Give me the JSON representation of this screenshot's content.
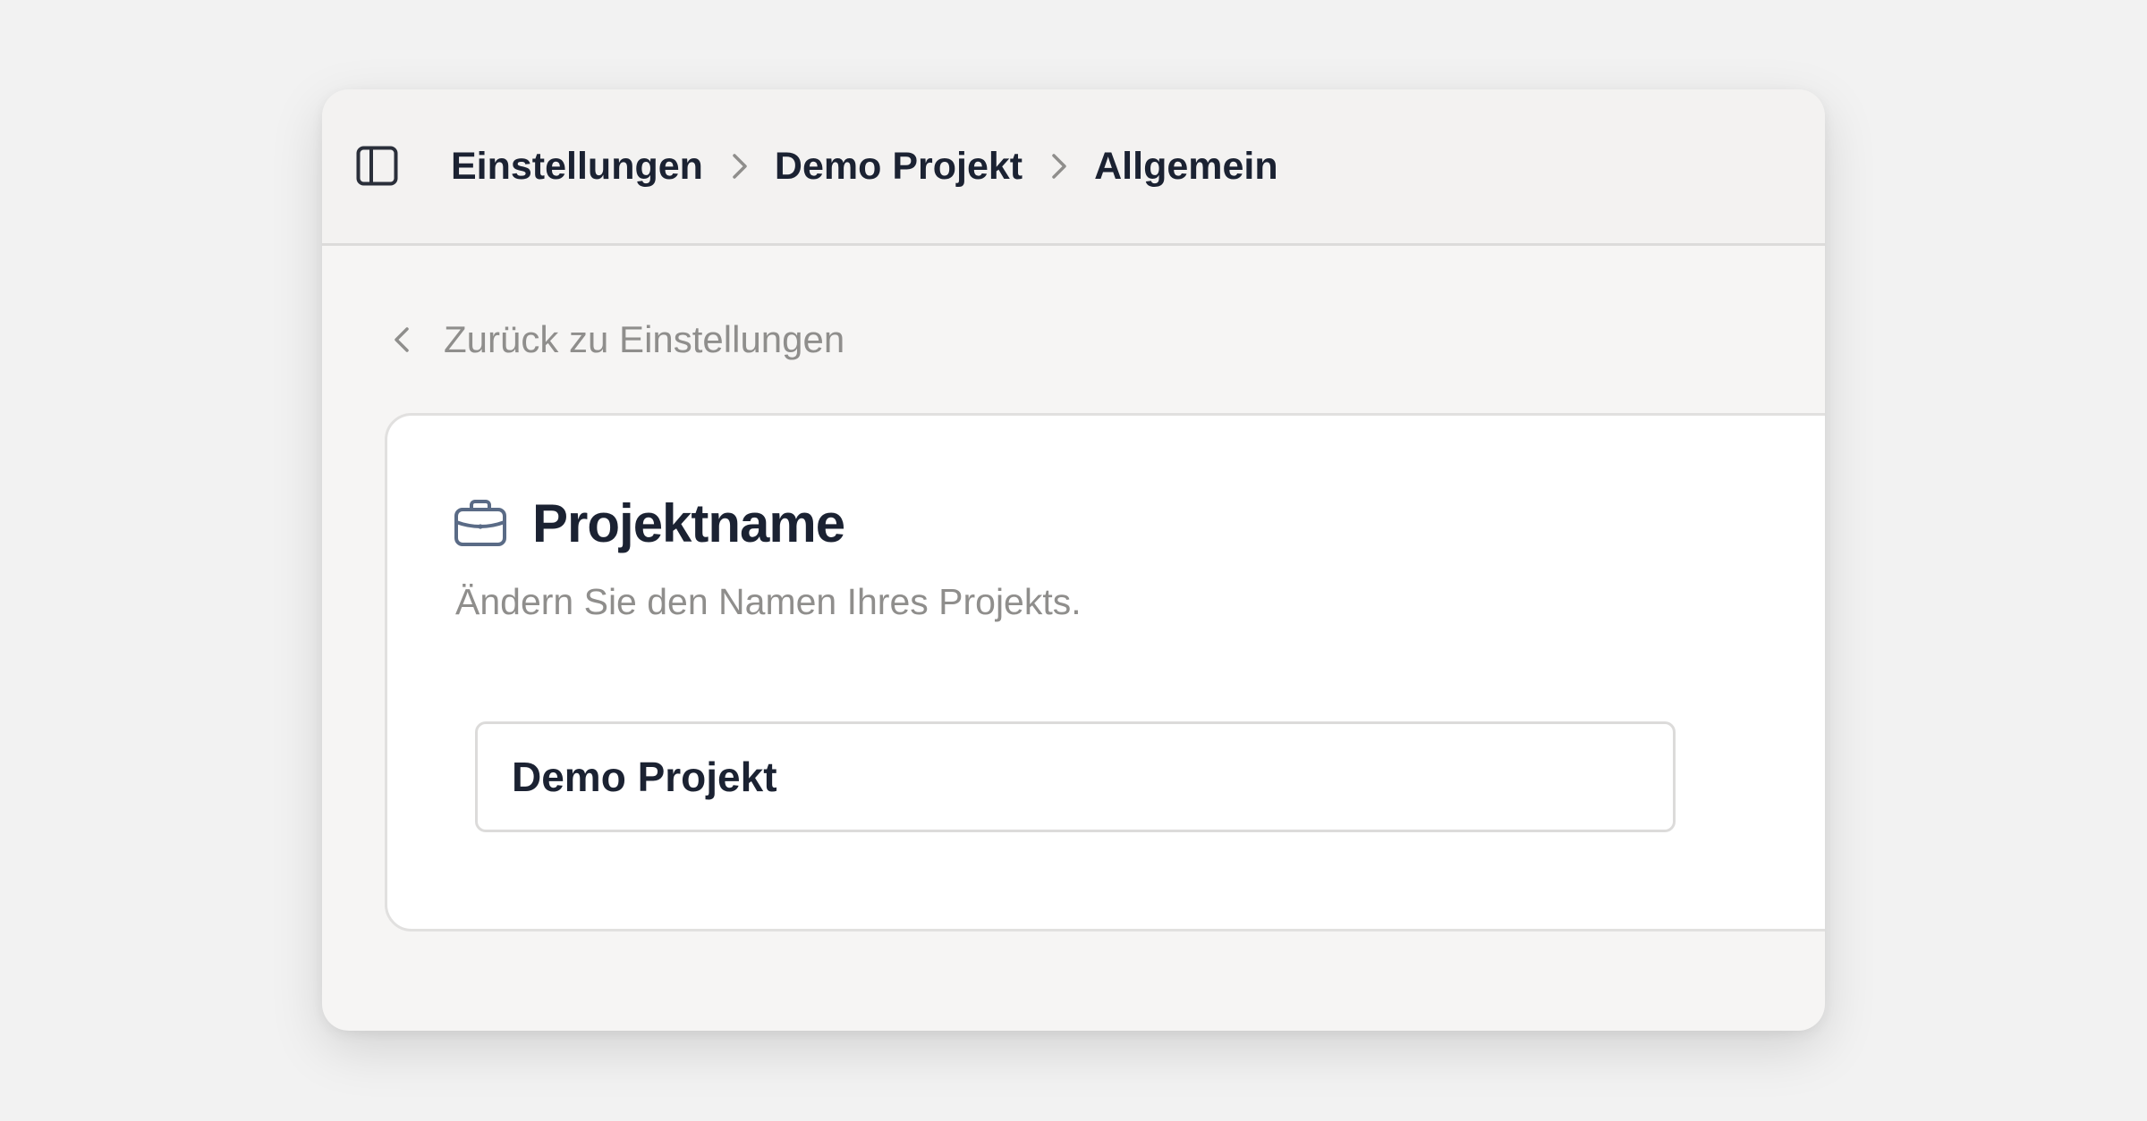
{
  "header": {
    "breadcrumb": [
      {
        "label": "Einstellungen"
      },
      {
        "label": "Demo Projekt"
      },
      {
        "label": "Allgemein"
      }
    ]
  },
  "back_link": {
    "label": "Zurück zu Einstellungen"
  },
  "project_name_card": {
    "title": "Projektname",
    "description": "Ändern Sie den Namen Ihres Projekts.",
    "input_value": "Demo Projekt"
  },
  "icons": {
    "sidebar_toggle": "sidebar-toggle-icon",
    "breadcrumb_separator": "chevron-right-icon",
    "back": "chevron-left-icon",
    "card": "briefcase-icon"
  },
  "colors": {
    "page_background": "#f2f2f2",
    "window_background": "#f6f5f4",
    "primary_text": "#1b2232",
    "muted_text": "#8f8e8c",
    "icon_blue_gray": "#5a6b86",
    "border": "#dcdbda"
  }
}
